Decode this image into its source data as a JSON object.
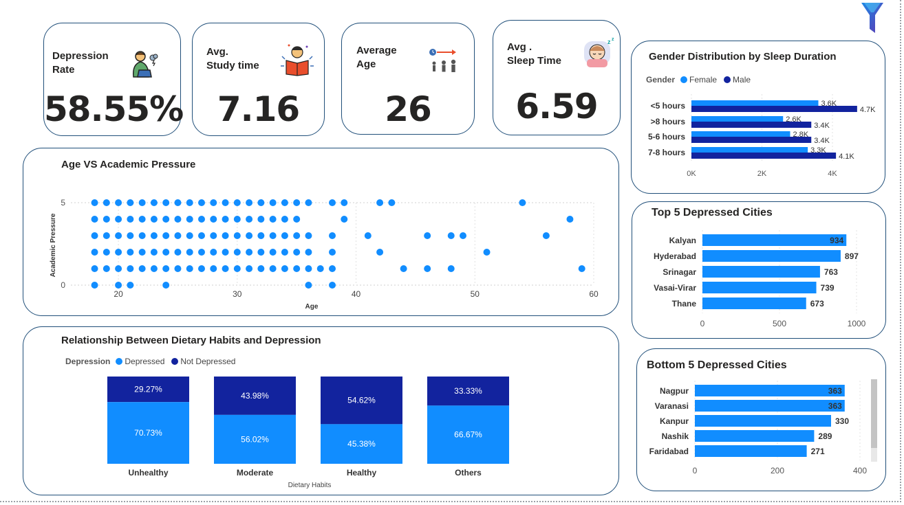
{
  "colors": {
    "primary": "#118dff",
    "dark": "#12239e",
    "border": "#1f4e79",
    "text": "#252423"
  },
  "kpis": [
    {
      "title": "Depression\nRate",
      "value": "58.55%",
      "icon": "depressed-person-icon"
    },
    {
      "title": "Avg.\nStudy time",
      "value": "7.16",
      "icon": "student-reading-icon"
    },
    {
      "title": "Average\nAge",
      "value": "26",
      "icon": "age-group-icon"
    },
    {
      "title": "Avg .\nSleep Time",
      "value": "6.59",
      "icon": "sleeping-face-icon"
    }
  ],
  "chart_data": [
    {
      "id": "scatter",
      "type": "scatter",
      "title": "Age VS  Academic Pressure",
      "xlabel": "Age",
      "ylabel": "Academic Pressure",
      "xlim": [
        16,
        60
      ],
      "ylim": [
        0,
        5
      ],
      "xticks": [
        20,
        30,
        40,
        50,
        60
      ],
      "yticks": [
        0,
        5
      ],
      "color": "#118dff",
      "points": [
        [
          18,
          5
        ],
        [
          19,
          5
        ],
        [
          20,
          5
        ],
        [
          21,
          5
        ],
        [
          22,
          5
        ],
        [
          23,
          5
        ],
        [
          24,
          5
        ],
        [
          25,
          5
        ],
        [
          26,
          5
        ],
        [
          27,
          5
        ],
        [
          28,
          5
        ],
        [
          29,
          5
        ],
        [
          30,
          5
        ],
        [
          31,
          5
        ],
        [
          32,
          5
        ],
        [
          33,
          5
        ],
        [
          34,
          5
        ],
        [
          35,
          5
        ],
        [
          36,
          5
        ],
        [
          38,
          5
        ],
        [
          39,
          5
        ],
        [
          42,
          5
        ],
        [
          43,
          5
        ],
        [
          54,
          5
        ],
        [
          18,
          4
        ],
        [
          19,
          4
        ],
        [
          20,
          4
        ],
        [
          21,
          4
        ],
        [
          22,
          4
        ],
        [
          23,
          4
        ],
        [
          24,
          4
        ],
        [
          25,
          4
        ],
        [
          26,
          4
        ],
        [
          27,
          4
        ],
        [
          28,
          4
        ],
        [
          29,
          4
        ],
        [
          30,
          4
        ],
        [
          31,
          4
        ],
        [
          32,
          4
        ],
        [
          33,
          4
        ],
        [
          34,
          4
        ],
        [
          35,
          4
        ],
        [
          39,
          4
        ],
        [
          58,
          4
        ],
        [
          18,
          3
        ],
        [
          19,
          3
        ],
        [
          20,
          3
        ],
        [
          21,
          3
        ],
        [
          22,
          3
        ],
        [
          23,
          3
        ],
        [
          24,
          3
        ],
        [
          25,
          3
        ],
        [
          26,
          3
        ],
        [
          27,
          3
        ],
        [
          28,
          3
        ],
        [
          29,
          3
        ],
        [
          30,
          3
        ],
        [
          31,
          3
        ],
        [
          32,
          3
        ],
        [
          33,
          3
        ],
        [
          34,
          3
        ],
        [
          35,
          3
        ],
        [
          36,
          3
        ],
        [
          38,
          3
        ],
        [
          41,
          3
        ],
        [
          46,
          3
        ],
        [
          48,
          3
        ],
        [
          49,
          3
        ],
        [
          56,
          3
        ],
        [
          18,
          2
        ],
        [
          19,
          2
        ],
        [
          20,
          2
        ],
        [
          21,
          2
        ],
        [
          22,
          2
        ],
        [
          23,
          2
        ],
        [
          24,
          2
        ],
        [
          25,
          2
        ],
        [
          26,
          2
        ],
        [
          27,
          2
        ],
        [
          28,
          2
        ],
        [
          29,
          2
        ],
        [
          30,
          2
        ],
        [
          31,
          2
        ],
        [
          32,
          2
        ],
        [
          33,
          2
        ],
        [
          34,
          2
        ],
        [
          35,
          2
        ],
        [
          36,
          2
        ],
        [
          38,
          2
        ],
        [
          42,
          2
        ],
        [
          51,
          2
        ],
        [
          18,
          1
        ],
        [
          19,
          1
        ],
        [
          20,
          1
        ],
        [
          21,
          1
        ],
        [
          22,
          1
        ],
        [
          23,
          1
        ],
        [
          24,
          1
        ],
        [
          25,
          1
        ],
        [
          26,
          1
        ],
        [
          27,
          1
        ],
        [
          28,
          1
        ],
        [
          29,
          1
        ],
        [
          30,
          1
        ],
        [
          31,
          1
        ],
        [
          32,
          1
        ],
        [
          33,
          1
        ],
        [
          34,
          1
        ],
        [
          35,
          1
        ],
        [
          36,
          1
        ],
        [
          37,
          1
        ],
        [
          38,
          1
        ],
        [
          44,
          1
        ],
        [
          46,
          1
        ],
        [
          48,
          1
        ],
        [
          59,
          1
        ],
        [
          18,
          0
        ],
        [
          20,
          0
        ],
        [
          21,
          0
        ],
        [
          24,
          0
        ],
        [
          36,
          0
        ],
        [
          38,
          0
        ]
      ]
    },
    {
      "id": "gender",
      "type": "bar",
      "orientation": "horizontal",
      "title": "Gender Distribution by Sleep Duration",
      "legend_title": "Gender",
      "categories": [
        "<5 hours",
        ">8 hours",
        "5-6 hours",
        "7-8 hours"
      ],
      "series": [
        {
          "name": "Female",
          "color": "#118dff",
          "values": [
            3.6,
            2.6,
            2.8,
            3.3
          ],
          "labels": [
            "3.6K",
            "2.6K",
            "2.8K",
            "3.3K"
          ]
        },
        {
          "name": "Male",
          "color": "#12239e",
          "values": [
            4.7,
            3.4,
            3.4,
            4.1
          ],
          "labels": [
            "4.7K",
            "3.4K",
            "3.4K",
            "4.1K"
          ]
        }
      ],
      "xlim": [
        0,
        5
      ],
      "xticks": [
        0,
        2,
        4
      ],
      "xtick_labels": [
        "0K",
        "2K",
        "4K"
      ]
    },
    {
      "id": "top5",
      "type": "bar",
      "orientation": "horizontal",
      "title": "Top 5 Depressed Cities",
      "categories": [
        "Kalyan",
        "Hyderabad",
        "Srinagar",
        "Vasai-Virar",
        "Thane"
      ],
      "values": [
        934,
        897,
        763,
        739,
        673
      ],
      "color": "#118dff",
      "xlim": [
        0,
        1000
      ],
      "xticks": [
        0,
        500,
        1000
      ]
    },
    {
      "id": "bottom5",
      "type": "bar",
      "orientation": "horizontal",
      "title": "Bottom 5 Depressed Cities",
      "categories": [
        "Nagpur",
        "Varanasi",
        "Kanpur",
        "Nashik",
        "Faridabad"
      ],
      "values": [
        363,
        363,
        330,
        289,
        271
      ],
      "color": "#118dff",
      "xlim": [
        0,
        400
      ],
      "xticks": [
        0,
        200,
        400
      ]
    },
    {
      "id": "dietary",
      "type": "bar",
      "stacked": true,
      "percent": true,
      "title": "Relationship Between Dietary Habits and Depression",
      "legend_title": "Depression",
      "xlabel": "Dietary Habits",
      "categories": [
        "Unhealthy",
        "Moderate",
        "Healthy",
        "Others"
      ],
      "series": [
        {
          "name": "Depressed",
          "color": "#118dff",
          "values": [
            70.73,
            56.02,
            45.38,
            66.67
          ],
          "labels": [
            "70.73%",
            "56.02%",
            "45.38%",
            "66.67%"
          ]
        },
        {
          "name": "Not Depressed",
          "color": "#12239e",
          "values": [
            29.27,
            43.98,
            54.62,
            33.33
          ],
          "labels": [
            "29.27%",
            "43.98%",
            "54.62%",
            "33.33%"
          ]
        }
      ]
    }
  ]
}
